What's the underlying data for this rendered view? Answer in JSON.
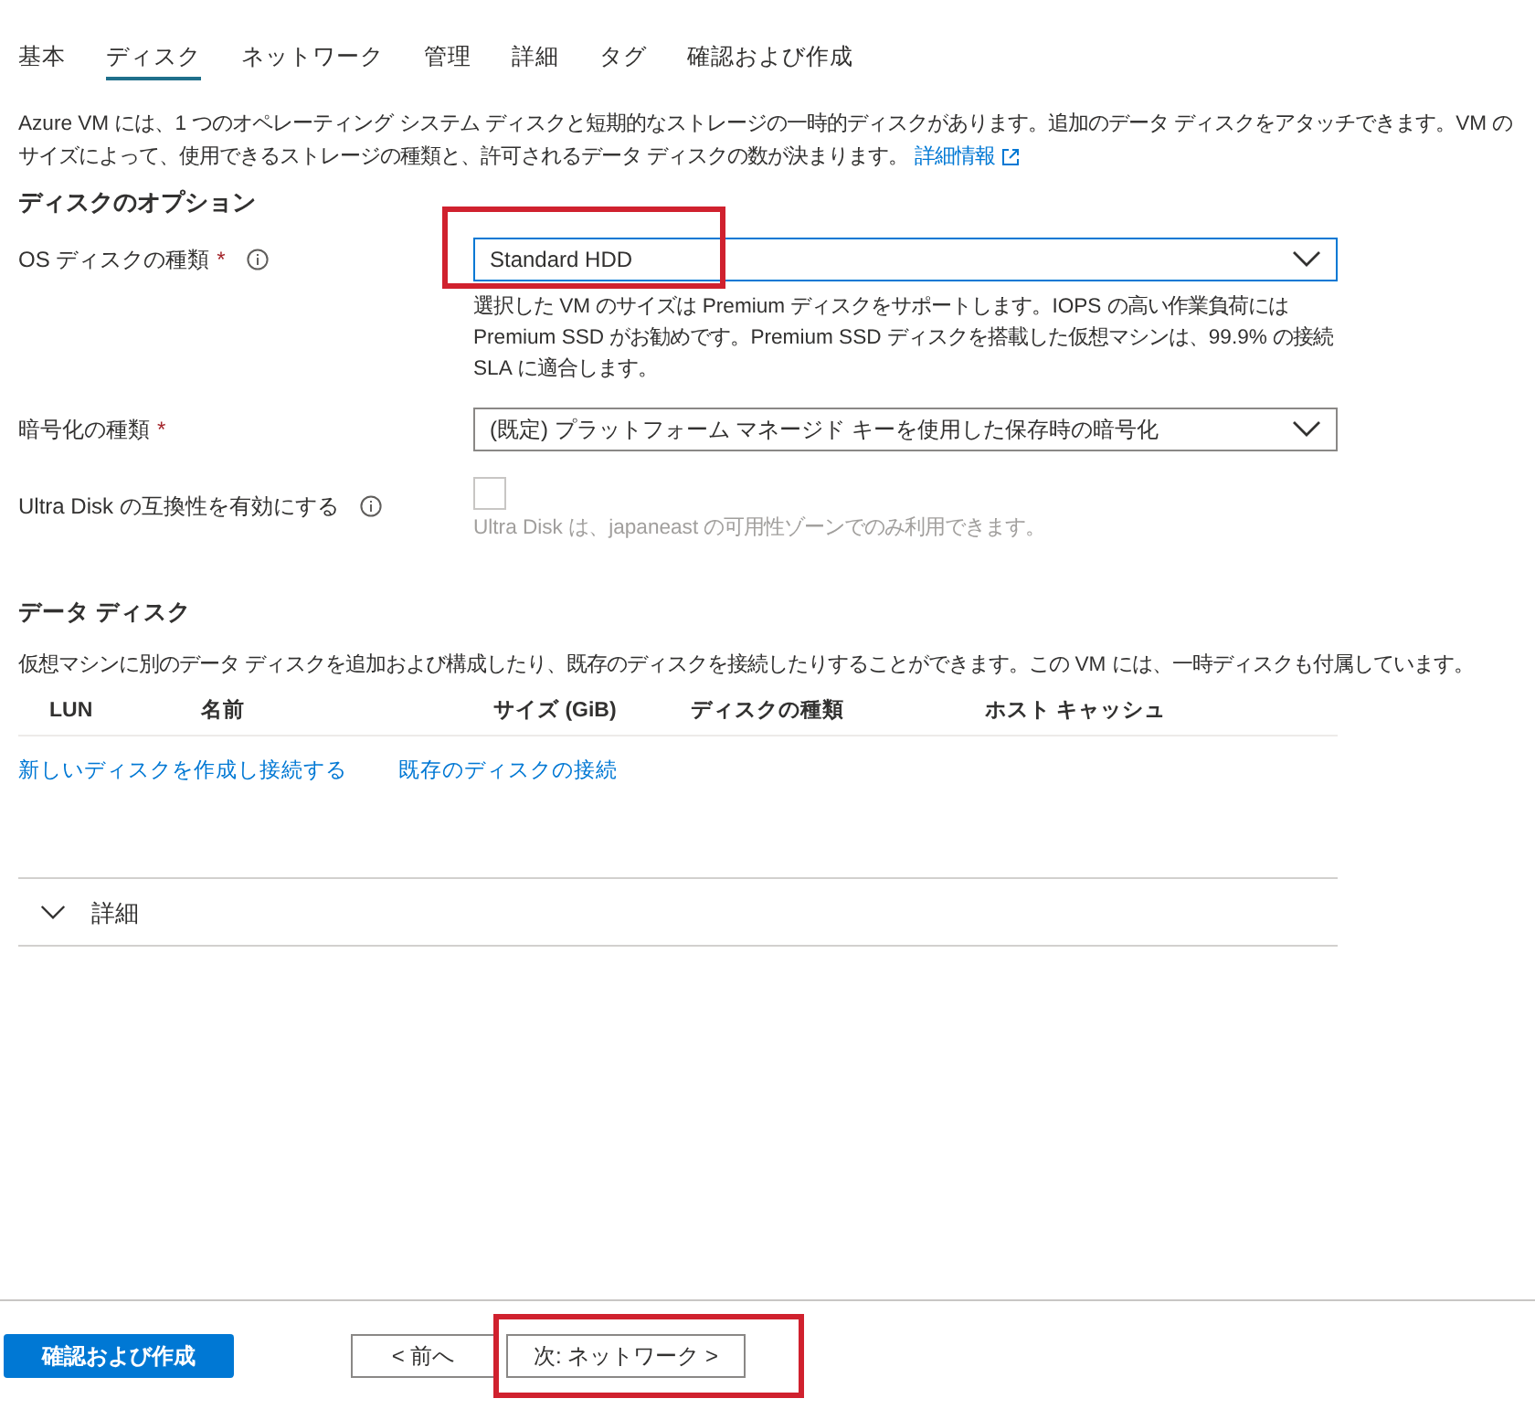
{
  "tabs": [
    {
      "label": "基本",
      "selected": false
    },
    {
      "label": "ディスク",
      "selected": true
    },
    {
      "label": "ネットワーク",
      "selected": false
    },
    {
      "label": "管理",
      "selected": false
    },
    {
      "label": "詳細",
      "selected": false
    },
    {
      "label": "タグ",
      "selected": false
    },
    {
      "label": "確認および作成",
      "selected": false
    }
  ],
  "intro": {
    "text": "Azure VM には、1 つのオペレーティング システム ディスクと短期的なストレージの一時的ディスクがあります。追加のデータ ディスクをアタッチできます。VM のサイズによって、使用できるストレージの種類と、許可されるデータ ディスクの数が決まります。",
    "link": "詳細情報"
  },
  "disk_options": {
    "heading": "ディスクのオプション",
    "os_disk": {
      "label": "OS ディスクの種類",
      "required": "*",
      "value": "Standard HDD",
      "highlighted": true,
      "hint": "選択した VM のサイズは Premium ディスクをサポートします。IOPS の高い作業負荷には Premium SSD がお勧めです。Premium SSD ディスクを搭載した仮想マシンは、99.9% の接続 SLA に適合します。"
    },
    "encryption": {
      "label": "暗号化の種類",
      "required": "*",
      "value": "(既定) プラットフォーム マネージド キーを使用した保存時の暗号化"
    },
    "ultra_disk": {
      "label": "Ultra Disk の互換性を有効にする",
      "checked": false,
      "disabled": true,
      "hint": "Ultra Disk は、japaneast の可用性ゾーンでのみ利用できます。"
    }
  },
  "data_disks": {
    "heading": "データ ディスク",
    "text": "仮想マシンに別のデータ ディスクを追加および構成したり、既存のディスクを接続したりすることができます。この VM には、一時ディスクも付属しています。",
    "columns": [
      "LUN",
      "名前",
      "サイズ (GiB)",
      "ディスクの種類",
      "ホスト キャッシュ"
    ],
    "links": [
      "新しいディスクを作成し接続する",
      "既存のディスクの接続"
    ]
  },
  "advanced": {
    "label": "詳細",
    "expanded": false
  },
  "footer": {
    "buttons": [
      {
        "label": "確認および作成",
        "kind": "primary",
        "highlighted": false
      },
      {
        "label": "< 前へ",
        "kind": "secondary",
        "highlighted": false
      },
      {
        "label": "次: ネットワーク >",
        "kind": "secondary",
        "highlighted": true
      }
    ]
  }
}
